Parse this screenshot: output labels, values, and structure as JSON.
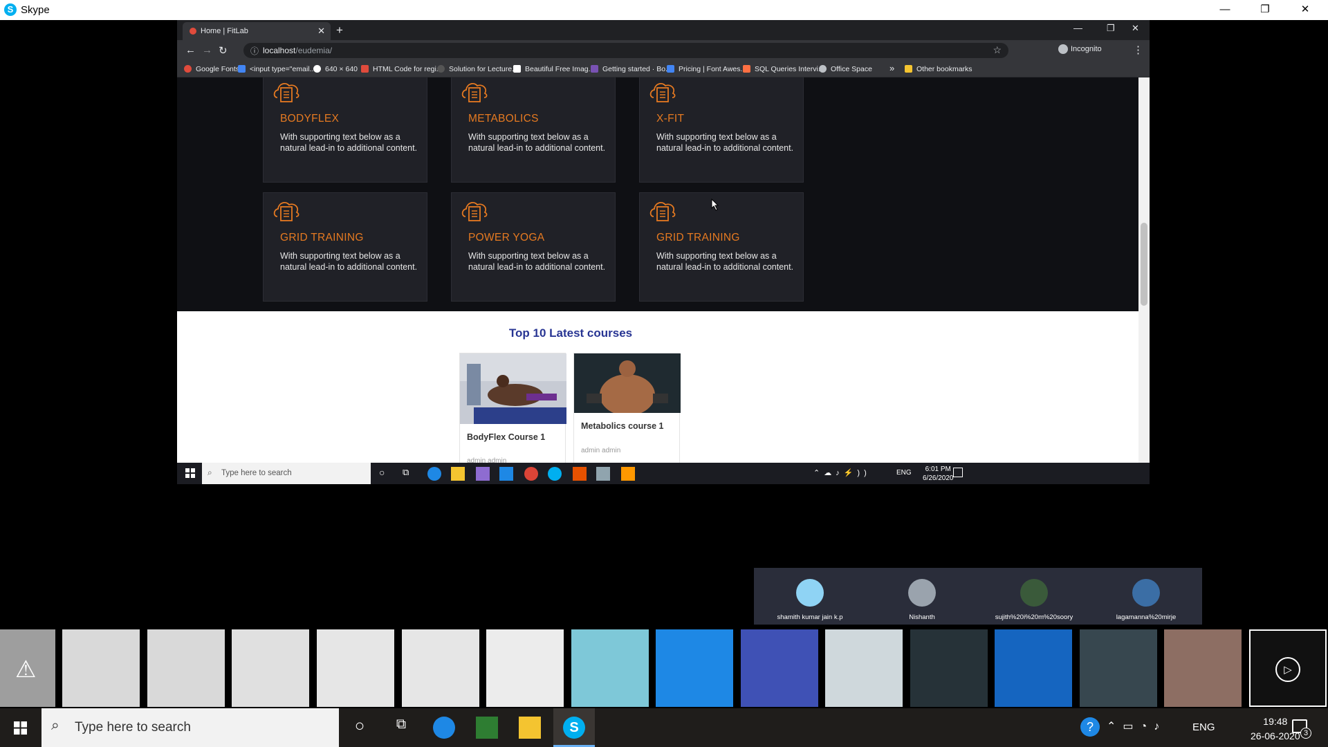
{
  "skype": {
    "title": "Skype",
    "minimize": "—",
    "restore": "❐",
    "close": "✕"
  },
  "chrome": {
    "tab_title": "Home | FitLab",
    "new_tab": "+",
    "url_host": "localhost",
    "url_path": "/eudemia/",
    "incognito": "Incognito",
    "bookmarks": [
      {
        "label": "Google Fonts",
        "color": "#e04b3c"
      },
      {
        "label": "<input type=\"email...",
        "color": "#4285f4"
      },
      {
        "label": "640 × 640",
        "color": "#ffffff"
      },
      {
        "label": "HTML Code for regi...",
        "color": "#e04b3c"
      },
      {
        "label": "Solution for Lecture...",
        "color": "#333333"
      },
      {
        "label": "Beautiful Free Imag...",
        "color": "#ffffff"
      },
      {
        "label": "Getting started · Bo...",
        "color": "#7952b3"
      },
      {
        "label": "Pricing | Font Awes...",
        "color": "#4285f4"
      },
      {
        "label": "SQL Queries Intervi...",
        "color": "#ff7043"
      },
      {
        "label": "Office Space",
        "color": "#bdc1c6"
      }
    ],
    "bookmarks_more": "»",
    "other_bookmarks": "Other bookmarks"
  },
  "programs": [
    {
      "title": "BODYFLEX",
      "text": "With supporting text below as a natural lead-in to additional content."
    },
    {
      "title": "METABOLICS",
      "text": "With supporting text below as a natural lead-in to additional content."
    },
    {
      "title": "X-FIT",
      "text": "With supporting text below as a natural lead-in to additional content."
    },
    {
      "title": "GRID TRAINING",
      "text": "With supporting text below as a natural lead-in to additional content."
    },
    {
      "title": "POWER YOGA",
      "text": "With supporting text below as a natural lead-in to additional content."
    },
    {
      "title": "GRID TRAINING",
      "text": "With supporting text below as a natural lead-in to additional content."
    }
  ],
  "courses": {
    "heading": "Top 10 Latest courses",
    "items": [
      {
        "name": "BodyFlex Course 1",
        "author": "admin admin"
      },
      {
        "name": "Metabolics course 1",
        "author": "admin admin"
      }
    ]
  },
  "inner_taskbar": {
    "search_placeholder": "Type here to search",
    "lang": "ENG",
    "time": "6:01 PM",
    "date": "6/26/2020"
  },
  "participants": [
    {
      "name": "shamith kumar jain k.p",
      "color": "#8fd3f4"
    },
    {
      "name": "Nishanth",
      "color": "#9aa3ad"
    },
    {
      "name": "sujith%20i%20m%20soory",
      "color": "#3a5a3a"
    },
    {
      "name": "lagamanna%20mirje",
      "color": "#3b6ea5"
    }
  ],
  "taskbar": {
    "search_placeholder": "Type here to search",
    "lang": "ENG",
    "time": "19:48",
    "date": "26-06-2020",
    "notifications": "3"
  },
  "colors": {
    "accent_orange": "#e67a21",
    "heading_blue": "#283593",
    "skype_blue": "#00aff0"
  }
}
